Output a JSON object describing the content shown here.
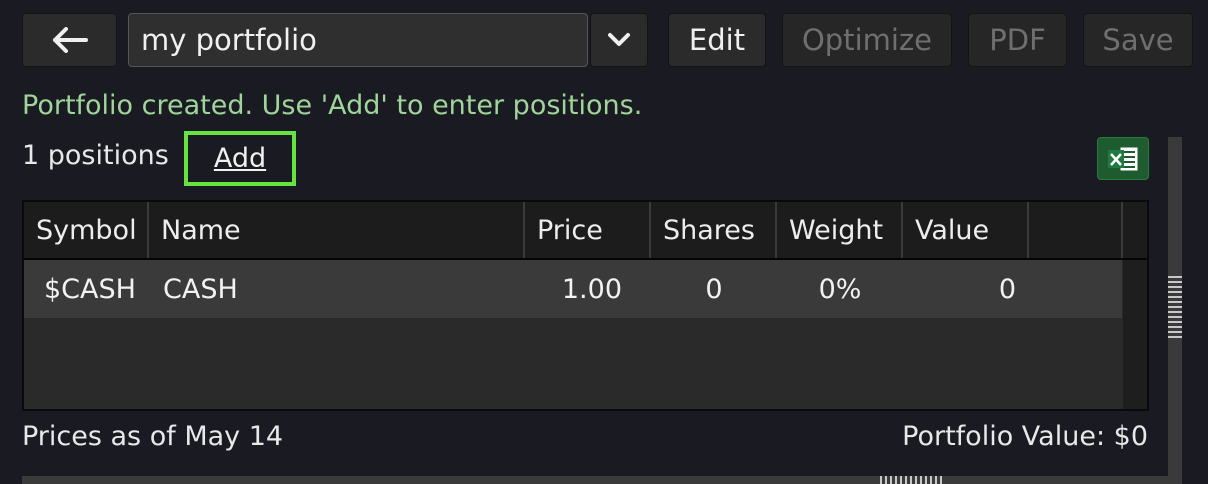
{
  "toolbar": {
    "back_icon": "left-arrow-icon",
    "portfolio_name": "my portfolio",
    "dropdown_icon": "chevron-down-icon",
    "edit_label": "Edit",
    "optimize_label": "Optimize",
    "pdf_label": "PDF",
    "save_label": "Save"
  },
  "status_message": "Portfolio created. Use 'Add' to enter positions.",
  "positions_count": "1 positions",
  "add_label": "Add",
  "excel_icon": "excel-export-icon",
  "table": {
    "columns": [
      "Symbol",
      "Name",
      "Price",
      "Shares",
      "Weight",
      "Value"
    ],
    "rows": [
      {
        "symbol": "$CASH",
        "name": "CASH",
        "price": "1.00",
        "shares": "0",
        "weight": "0%",
        "value": "0"
      }
    ]
  },
  "footer": {
    "prices_date": "Prices as of May 14",
    "portfolio_value": "Portfolio Value: $0"
  },
  "colors": {
    "background": "#1a1a22",
    "status_text": "#9fd49a",
    "highlight": "#66e33e",
    "excel": "#1e5b2e"
  }
}
